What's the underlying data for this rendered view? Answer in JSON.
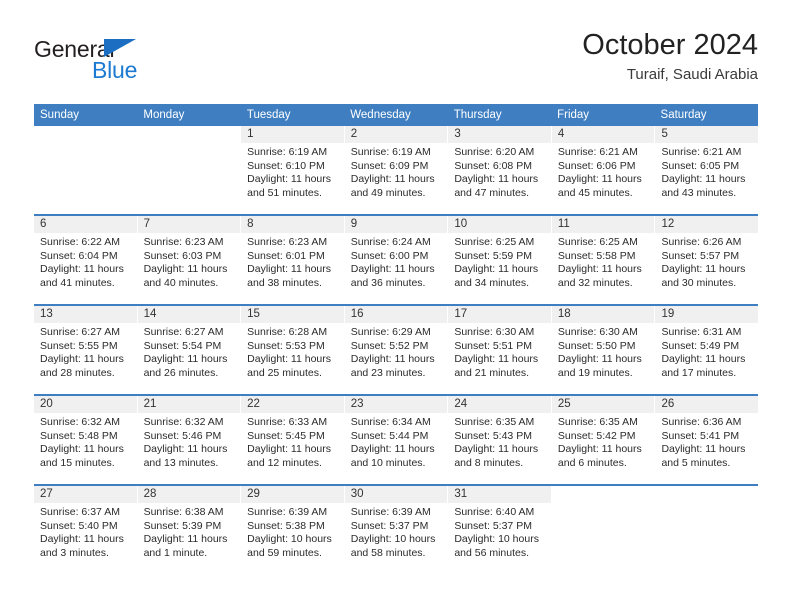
{
  "brand": {
    "name_part1": "General",
    "name_part2": "Blue",
    "triangle_icon": "triangle-icon",
    "accent_color": "#1b7ad1"
  },
  "header": {
    "title": "October 2024",
    "subtitle": "Turaif, Saudi Arabia"
  },
  "calendar": {
    "header_color": "#3f7fc1",
    "daynum_bg": "#f0f0f0",
    "weekdays": [
      "Sunday",
      "Monday",
      "Tuesday",
      "Wednesday",
      "Thursday",
      "Friday",
      "Saturday"
    ],
    "weeks": [
      [
        {
          "blank": true
        },
        {
          "blank": true
        },
        {
          "day": "1",
          "sunrise": "Sunrise: 6:19 AM",
          "sunset": "Sunset: 6:10 PM",
          "daylight1": "Daylight: 11 hours",
          "daylight2": "and 51 minutes."
        },
        {
          "day": "2",
          "sunrise": "Sunrise: 6:19 AM",
          "sunset": "Sunset: 6:09 PM",
          "daylight1": "Daylight: 11 hours",
          "daylight2": "and 49 minutes."
        },
        {
          "day": "3",
          "sunrise": "Sunrise: 6:20 AM",
          "sunset": "Sunset: 6:08 PM",
          "daylight1": "Daylight: 11 hours",
          "daylight2": "and 47 minutes."
        },
        {
          "day": "4",
          "sunrise": "Sunrise: 6:21 AM",
          "sunset": "Sunset: 6:06 PM",
          "daylight1": "Daylight: 11 hours",
          "daylight2": "and 45 minutes."
        },
        {
          "day": "5",
          "sunrise": "Sunrise: 6:21 AM",
          "sunset": "Sunset: 6:05 PM",
          "daylight1": "Daylight: 11 hours",
          "daylight2": "and 43 minutes."
        }
      ],
      [
        {
          "day": "6",
          "sunrise": "Sunrise: 6:22 AM",
          "sunset": "Sunset: 6:04 PM",
          "daylight1": "Daylight: 11 hours",
          "daylight2": "and 41 minutes."
        },
        {
          "day": "7",
          "sunrise": "Sunrise: 6:23 AM",
          "sunset": "Sunset: 6:03 PM",
          "daylight1": "Daylight: 11 hours",
          "daylight2": "and 40 minutes."
        },
        {
          "day": "8",
          "sunrise": "Sunrise: 6:23 AM",
          "sunset": "Sunset: 6:01 PM",
          "daylight1": "Daylight: 11 hours",
          "daylight2": "and 38 minutes."
        },
        {
          "day": "9",
          "sunrise": "Sunrise: 6:24 AM",
          "sunset": "Sunset: 6:00 PM",
          "daylight1": "Daylight: 11 hours",
          "daylight2": "and 36 minutes."
        },
        {
          "day": "10",
          "sunrise": "Sunrise: 6:25 AM",
          "sunset": "Sunset: 5:59 PM",
          "daylight1": "Daylight: 11 hours",
          "daylight2": "and 34 minutes."
        },
        {
          "day": "11",
          "sunrise": "Sunrise: 6:25 AM",
          "sunset": "Sunset: 5:58 PM",
          "daylight1": "Daylight: 11 hours",
          "daylight2": "and 32 minutes."
        },
        {
          "day": "12",
          "sunrise": "Sunrise: 6:26 AM",
          "sunset": "Sunset: 5:57 PM",
          "daylight1": "Daylight: 11 hours",
          "daylight2": "and 30 minutes."
        }
      ],
      [
        {
          "day": "13",
          "sunrise": "Sunrise: 6:27 AM",
          "sunset": "Sunset: 5:55 PM",
          "daylight1": "Daylight: 11 hours",
          "daylight2": "and 28 minutes."
        },
        {
          "day": "14",
          "sunrise": "Sunrise: 6:27 AM",
          "sunset": "Sunset: 5:54 PM",
          "daylight1": "Daylight: 11 hours",
          "daylight2": "and 26 minutes."
        },
        {
          "day": "15",
          "sunrise": "Sunrise: 6:28 AM",
          "sunset": "Sunset: 5:53 PM",
          "daylight1": "Daylight: 11 hours",
          "daylight2": "and 25 minutes."
        },
        {
          "day": "16",
          "sunrise": "Sunrise: 6:29 AM",
          "sunset": "Sunset: 5:52 PM",
          "daylight1": "Daylight: 11 hours",
          "daylight2": "and 23 minutes."
        },
        {
          "day": "17",
          "sunrise": "Sunrise: 6:30 AM",
          "sunset": "Sunset: 5:51 PM",
          "daylight1": "Daylight: 11 hours",
          "daylight2": "and 21 minutes."
        },
        {
          "day": "18",
          "sunrise": "Sunrise: 6:30 AM",
          "sunset": "Sunset: 5:50 PM",
          "daylight1": "Daylight: 11 hours",
          "daylight2": "and 19 minutes."
        },
        {
          "day": "19",
          "sunrise": "Sunrise: 6:31 AM",
          "sunset": "Sunset: 5:49 PM",
          "daylight1": "Daylight: 11 hours",
          "daylight2": "and 17 minutes."
        }
      ],
      [
        {
          "day": "20",
          "sunrise": "Sunrise: 6:32 AM",
          "sunset": "Sunset: 5:48 PM",
          "daylight1": "Daylight: 11 hours",
          "daylight2": "and 15 minutes."
        },
        {
          "day": "21",
          "sunrise": "Sunrise: 6:32 AM",
          "sunset": "Sunset: 5:46 PM",
          "daylight1": "Daylight: 11 hours",
          "daylight2": "and 13 minutes."
        },
        {
          "day": "22",
          "sunrise": "Sunrise: 6:33 AM",
          "sunset": "Sunset: 5:45 PM",
          "daylight1": "Daylight: 11 hours",
          "daylight2": "and 12 minutes."
        },
        {
          "day": "23",
          "sunrise": "Sunrise: 6:34 AM",
          "sunset": "Sunset: 5:44 PM",
          "daylight1": "Daylight: 11 hours",
          "daylight2": "and 10 minutes."
        },
        {
          "day": "24",
          "sunrise": "Sunrise: 6:35 AM",
          "sunset": "Sunset: 5:43 PM",
          "daylight1": "Daylight: 11 hours",
          "daylight2": "and 8 minutes."
        },
        {
          "day": "25",
          "sunrise": "Sunrise: 6:35 AM",
          "sunset": "Sunset: 5:42 PM",
          "daylight1": "Daylight: 11 hours",
          "daylight2": "and 6 minutes."
        },
        {
          "day": "26",
          "sunrise": "Sunrise: 6:36 AM",
          "sunset": "Sunset: 5:41 PM",
          "daylight1": "Daylight: 11 hours",
          "daylight2": "and 5 minutes."
        }
      ],
      [
        {
          "day": "27",
          "sunrise": "Sunrise: 6:37 AM",
          "sunset": "Sunset: 5:40 PM",
          "daylight1": "Daylight: 11 hours",
          "daylight2": "and 3 minutes."
        },
        {
          "day": "28",
          "sunrise": "Sunrise: 6:38 AM",
          "sunset": "Sunset: 5:39 PM",
          "daylight1": "Daylight: 11 hours",
          "daylight2": "and 1 minute."
        },
        {
          "day": "29",
          "sunrise": "Sunrise: 6:39 AM",
          "sunset": "Sunset: 5:38 PM",
          "daylight1": "Daylight: 10 hours",
          "daylight2": "and 59 minutes."
        },
        {
          "day": "30",
          "sunrise": "Sunrise: 6:39 AM",
          "sunset": "Sunset: 5:37 PM",
          "daylight1": "Daylight: 10 hours",
          "daylight2": "and 58 minutes."
        },
        {
          "day": "31",
          "sunrise": "Sunrise: 6:40 AM",
          "sunset": "Sunset: 5:37 PM",
          "daylight1": "Daylight: 10 hours",
          "daylight2": "and 56 minutes."
        },
        {
          "blank": true
        },
        {
          "blank": true
        }
      ]
    ]
  }
}
